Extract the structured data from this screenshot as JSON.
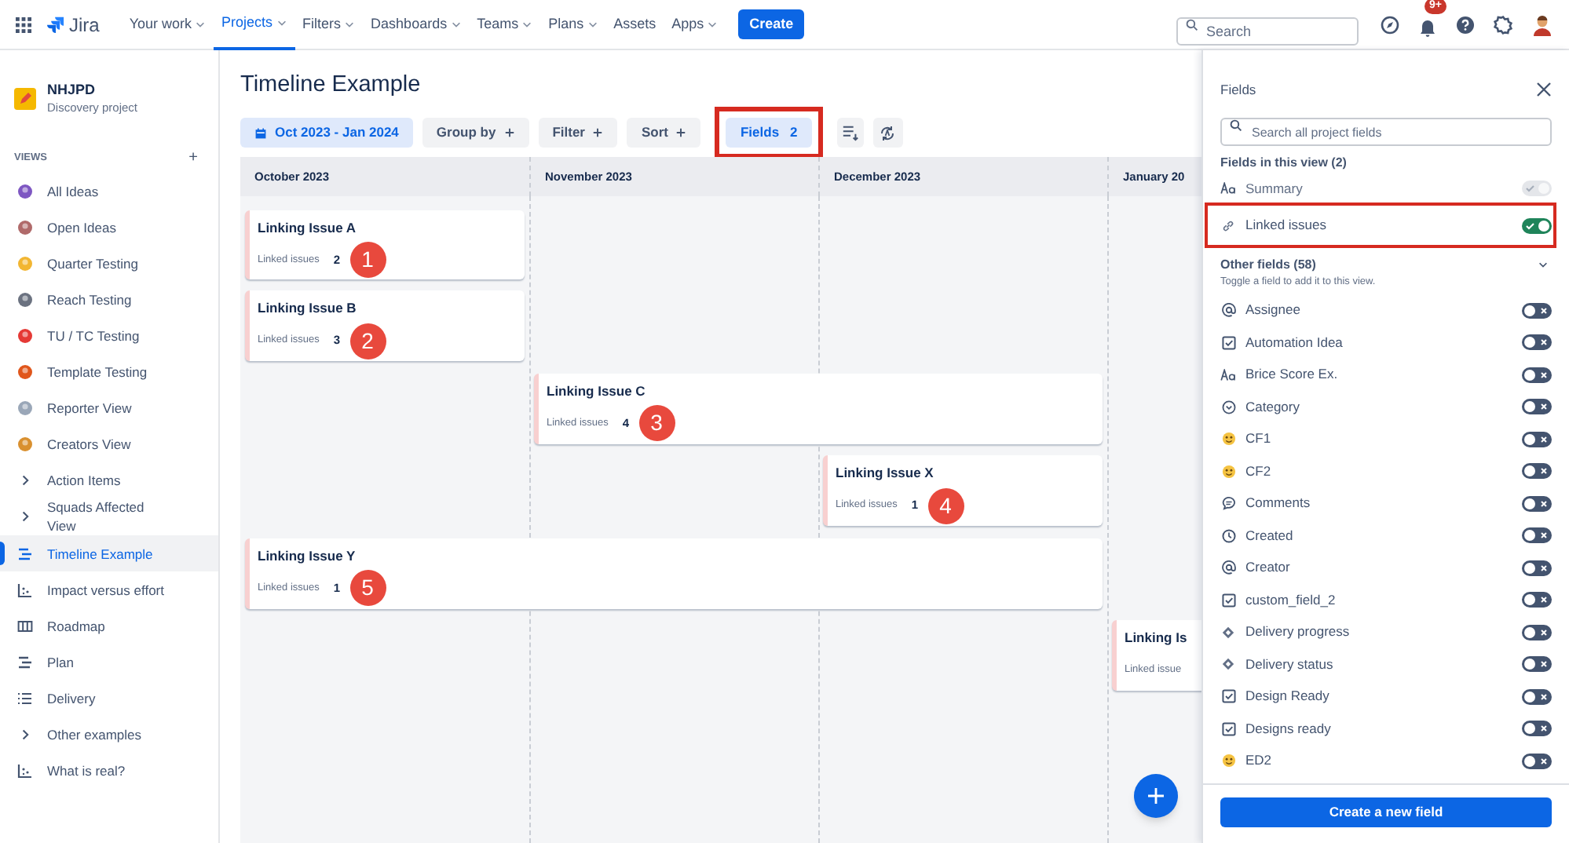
{
  "nav": {
    "product": "Jira",
    "menu": [
      {
        "label": "Your work",
        "dropdown": true,
        "selected": false
      },
      {
        "label": "Projects",
        "dropdown": true,
        "selected": true
      },
      {
        "label": "Filters",
        "dropdown": true,
        "selected": false
      },
      {
        "label": "Dashboards",
        "dropdown": true,
        "selected": false
      },
      {
        "label": "Teams",
        "dropdown": true,
        "selected": false
      },
      {
        "label": "Plans",
        "dropdown": true,
        "selected": false
      },
      {
        "label": "Assets",
        "dropdown": false,
        "selected": false
      },
      {
        "label": "Apps",
        "dropdown": true,
        "selected": false
      }
    ],
    "create": "Create",
    "search": {
      "placeholder": "Search"
    },
    "notifications": "9+"
  },
  "project": {
    "name": "NHJPD",
    "type": "Discovery project"
  },
  "sidebar": {
    "heading": "VIEWS",
    "add": "+",
    "items": [
      {
        "label": "All Ideas",
        "kind": "emoji",
        "color": "#7e57c2",
        "selected": false
      },
      {
        "label": "Open Ideas",
        "kind": "emoji",
        "color": "#b06a6a",
        "selected": false
      },
      {
        "label": "Quarter Testing",
        "kind": "emoji",
        "color": "#f2b632",
        "selected": false
      },
      {
        "label": "Reach Testing",
        "kind": "emoji",
        "color": "#6b7280",
        "selected": false
      },
      {
        "label": "TU / TC Testing",
        "kind": "emoji",
        "color": "#e53935",
        "selected": false
      },
      {
        "label": "Template Testing",
        "kind": "emoji",
        "color": "#e0561b",
        "selected": false
      },
      {
        "label": "Reporter View",
        "kind": "emoji",
        "color": "#9aa7b8",
        "selected": false
      },
      {
        "label": "Creators View",
        "kind": "emoji",
        "color": "#d9902f",
        "selected": false
      },
      {
        "label": "Action Items",
        "kind": "group",
        "selected": false
      },
      {
        "label": "Squads Affected View",
        "kind": "group",
        "selected": false
      },
      {
        "label": "Timeline Example",
        "kind": "timeline",
        "selected": true
      },
      {
        "label": "Impact versus effort",
        "kind": "matrix",
        "selected": false
      },
      {
        "label": "Roadmap",
        "kind": "board",
        "selected": false
      },
      {
        "label": "Plan",
        "kind": "timeline",
        "selected": false
      },
      {
        "label": "Delivery",
        "kind": "list",
        "selected": false
      },
      {
        "label": "Other examples",
        "kind": "group",
        "selected": false
      },
      {
        "label": "What is real?",
        "kind": "matrix",
        "selected": false
      }
    ]
  },
  "view": {
    "title": "Timeline Example",
    "toolbar": [
      {
        "label": "Oct 2023 - Jan 2024",
        "kind": "date",
        "selected": true,
        "highlighted": false
      },
      {
        "label": "Group by",
        "kind": "add",
        "selected": false,
        "highlighted": false
      },
      {
        "label": "Filter",
        "kind": "add",
        "selected": false,
        "highlighted": false
      },
      {
        "label": "Sort",
        "kind": "add",
        "selected": false,
        "highlighted": false
      },
      {
        "label": "Fields",
        "count": "2",
        "kind": "count",
        "selected": true,
        "highlighted": true
      }
    ],
    "months": [
      "October 2023",
      "November 2023",
      "December 2023",
      "January 20"
    ],
    "cards": [
      {
        "title": "Linking Issue A",
        "field": "Linked issues",
        "value": "2",
        "marker": "1"
      },
      {
        "title": "Linking Issue B",
        "field": "Linked issues",
        "value": "3",
        "marker": "2"
      },
      {
        "title": "Linking Issue C",
        "field": "Linked issues",
        "value": "4",
        "marker": "3"
      },
      {
        "title": "Linking Issue X",
        "field": "Linked issues",
        "value": "1",
        "marker": "4"
      },
      {
        "title": "Linking Issue Y",
        "field": "Linked issues",
        "value": "1",
        "marker": "5"
      },
      {
        "title": "Linking Is",
        "field": "Linked issue"
      }
    ]
  },
  "fields_panel": {
    "title": "Fields",
    "search": {
      "placeholder": "Search all project fields"
    },
    "in_view": {
      "heading": "Fields in this view (2)",
      "items": [
        {
          "label": "Summary",
          "kind": "text",
          "on": true,
          "disabled": true,
          "highlighted": false
        },
        {
          "label": "Linked issues",
          "kind": "link",
          "on": true,
          "disabled": false,
          "highlighted": true
        }
      ]
    },
    "other": {
      "heading": "Other fields (58)",
      "expanded": true,
      "hint": "Toggle a field to add it to this view.",
      "items": [
        {
          "label": "Assignee",
          "kind": "people",
          "on": false
        },
        {
          "label": "Automation Idea",
          "kind": "checkbox",
          "on": false
        },
        {
          "label": "Brice Score Ex.",
          "kind": "text",
          "on": false
        },
        {
          "label": "Category",
          "kind": "select",
          "on": false
        },
        {
          "label": "CF1",
          "kind": "emoji",
          "on": false
        },
        {
          "label": "CF2",
          "kind": "emoji",
          "on": false
        },
        {
          "label": "Comments",
          "kind": "comments",
          "on": false
        },
        {
          "label": "Created",
          "kind": "date",
          "on": false
        },
        {
          "label": "Creator",
          "kind": "people",
          "on": false
        },
        {
          "label": "custom_field_2",
          "kind": "checkbox",
          "on": false
        },
        {
          "label": "Delivery progress",
          "kind": "delivery",
          "on": false
        },
        {
          "label": "Delivery status",
          "kind": "delivery",
          "on": false
        },
        {
          "label": "Design Ready",
          "kind": "checkbox",
          "on": false
        },
        {
          "label": "Designs ready",
          "kind": "checkbox",
          "on": false
        },
        {
          "label": "ED2",
          "kind": "emoji",
          "on": false
        }
      ]
    },
    "create": "Create a new field"
  }
}
